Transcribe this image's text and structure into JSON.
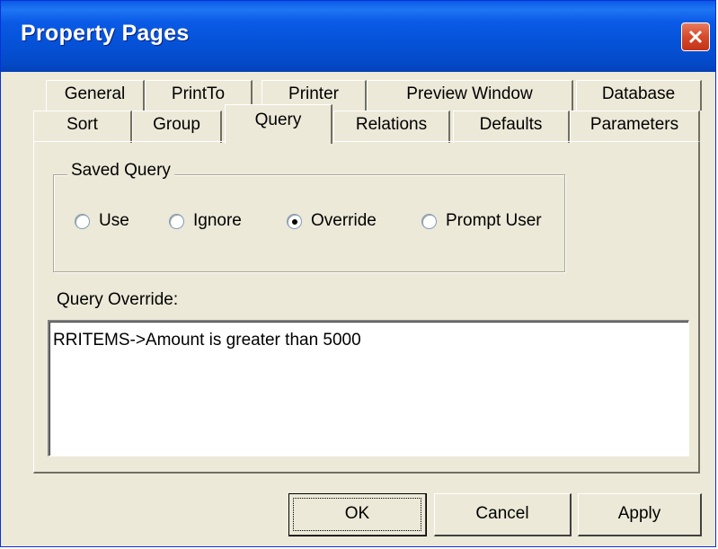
{
  "window": {
    "title": "Property Pages"
  },
  "tabs": {
    "row1": [
      "General",
      "PrintTo",
      "Printer",
      "Preview Window",
      "Database"
    ],
    "row2": [
      "Sort",
      "Group",
      "Query",
      "Relations",
      "Defaults",
      "Parameters"
    ],
    "active": "Query"
  },
  "saved_query": {
    "label": "Saved Query",
    "options": [
      "Use",
      "Ignore",
      "Override",
      "Prompt User"
    ],
    "selected": "Override"
  },
  "query_override": {
    "label": "Query Override:",
    "value": "RRITEMS->Amount is greater than 5000"
  },
  "buttons": {
    "ok": "OK",
    "cancel": "Cancel",
    "apply": "Apply"
  },
  "colors": {
    "titlebar": "#0a5ae6",
    "close": "#d6492a",
    "face": "#ece9d8"
  }
}
